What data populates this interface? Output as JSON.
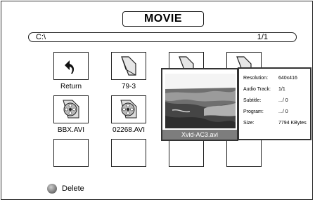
{
  "header": {
    "title": "MOVIE"
  },
  "path_bar": {
    "path": "C:\\",
    "page": "1/1"
  },
  "grid": {
    "row1_labels": [
      "Return",
      "79-3"
    ],
    "row2_labels": [
      "BBX.AVI",
      "02268.AVI"
    ]
  },
  "preview": {
    "filename": "Xvid-AC3.avi",
    "info": [
      {
        "label": "Resolution:",
        "value": "640x416"
      },
      {
        "label": "Audio Track:",
        "value": "1/1"
      },
      {
        "label": "Subtitle:",
        "value": ".../ 0"
      },
      {
        "label": "Program:",
        "value": ".../ 0"
      },
      {
        "label": "Size:",
        "value": "7794 KBytes"
      }
    ]
  },
  "footer": {
    "delete_label": "Delete"
  }
}
